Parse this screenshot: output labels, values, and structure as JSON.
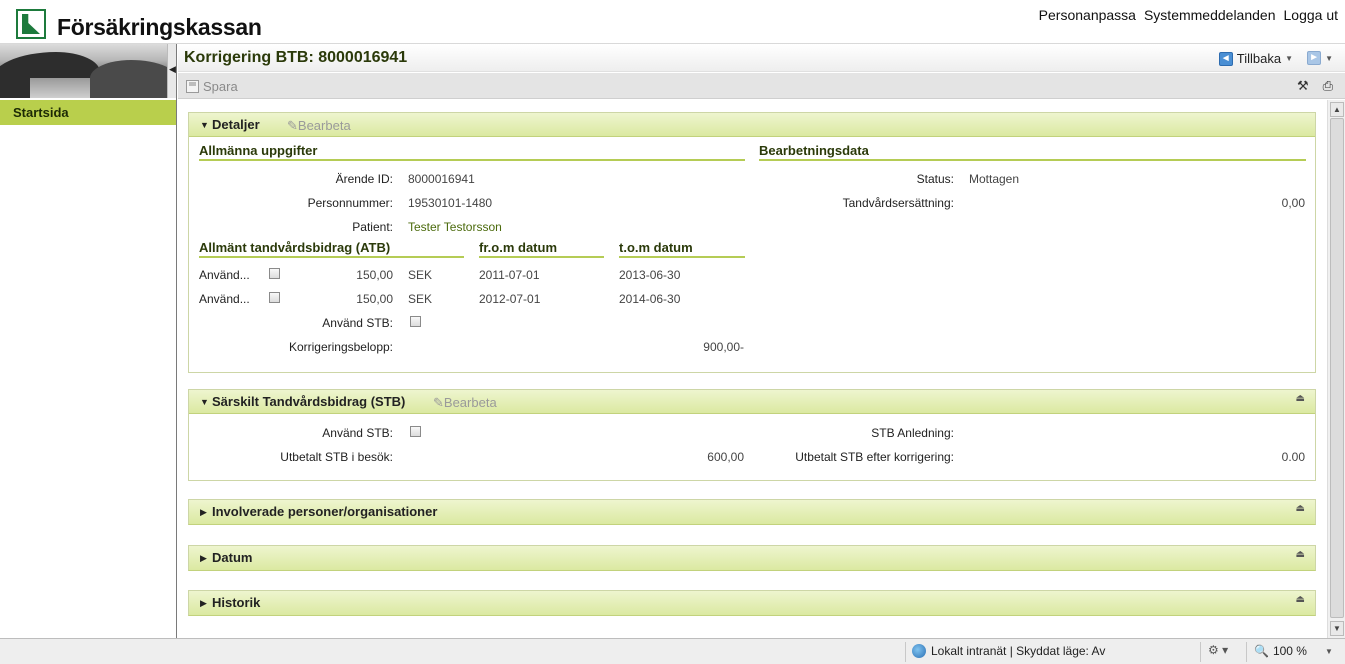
{
  "header": {
    "brand": "Försäkringskassan",
    "links": [
      "Personanpassa",
      "Systemmeddelanden",
      "Logga ut"
    ]
  },
  "sidebar": {
    "items": [
      {
        "label": "Startsida"
      }
    ]
  },
  "page": {
    "title": "Korrigering BTB: 8000016941",
    "back_label": "Tillbaka",
    "save_label": "Spara"
  },
  "details": {
    "title": "Detaljer",
    "edit_label": "Bearbeta",
    "general_heading": "Allmänna uppgifter",
    "processing_heading": "Bearbetningsdata",
    "arende_label": "Ärende ID:",
    "arende_value": "8000016941",
    "person_label": "Personnummer:",
    "person_value": "19530101-1480",
    "patient_label": "Patient:",
    "patient_value": "Tester Testorsson",
    "status_label": "Status:",
    "status_value": "Mottagen",
    "ersattning_label": "Tandvårdsersättning:",
    "ersattning_value": "0,00",
    "atb_heading": "Allmänt tandvårdsbidrag (ATB)",
    "from_heading": "fr.o.m datum",
    "tom_heading": "t.o.m datum",
    "atb_rows": [
      {
        "label": "Använd...",
        "amount": "150,00",
        "currency": "SEK",
        "from": "2011-07-01",
        "to": "2013-06-30"
      },
      {
        "label": "Använd...",
        "amount": "150,00",
        "currency": "SEK",
        "from": "2012-07-01",
        "to": "2014-06-30"
      }
    ],
    "use_stb_label": "Använd STB:",
    "korr_label": "Korrigeringsbelopp:",
    "korr_value": "900,00-"
  },
  "stb": {
    "title": "Särskilt Tandvårdsbidrag (STB)",
    "edit_label": "Bearbeta",
    "use_stb_label": "Använd STB:",
    "anledning_label": "STB Anledning:",
    "utbetalt_label": "Utbetalt STB i besök:",
    "utbetalt_value": "600,00",
    "efter_label": "Utbetalt STB efter korrigering:",
    "efter_value": "0.00"
  },
  "collapsed_panels": [
    "Involverade personer/organisationer",
    "Datum",
    "Historik"
  ],
  "statusbar": {
    "zone": "Lokalt intranät | Skyddat läge: Av",
    "zoom": "100 %"
  },
  "colors": {
    "accent": "#b9cf4c",
    "title": "#2b3a0a"
  }
}
